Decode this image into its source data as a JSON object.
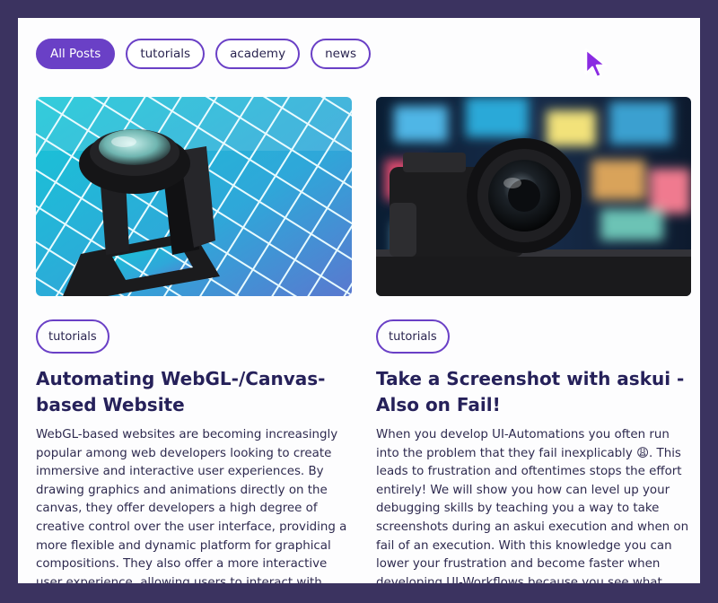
{
  "filters": {
    "all": "All Posts",
    "tutorials": "tutorials",
    "academy": "academy",
    "news": "news"
  },
  "posts": [
    {
      "tag": "tutorials",
      "title": "Automating WebGL-/Canvas-based Website",
      "excerpt": "WebGL-based websites are becoming increasingly popular among web developers looking to create immersive and interactive user experiences. By drawing graphics and animations directly on the canvas, they offer developers a high degree of creative control over the user interface, providing a more flexible and dynamic platform for graphical compositions. They also offer a more interactive user experience, allowing users to interact with graphics"
    },
    {
      "tag": "tutorials",
      "title": "Take a Screenshot with askui - Also on Fail!",
      "excerpt": "When you develop UI-Automations you often run into the problem that they fail inexplicably 😩. This leads to frustration and oftentimes stops the effort entirely! We will show you how can level up your debugging skills by teaching you a way to take screenshots during an askui execution and when on fail of an execution. With this knowledge you can lower your frustration and become faster when developing UI-Workflows because you see what askui sees"
    }
  ],
  "colors": {
    "accent": "#6a40c6",
    "background": "#3b3360",
    "title": "#26215a"
  }
}
